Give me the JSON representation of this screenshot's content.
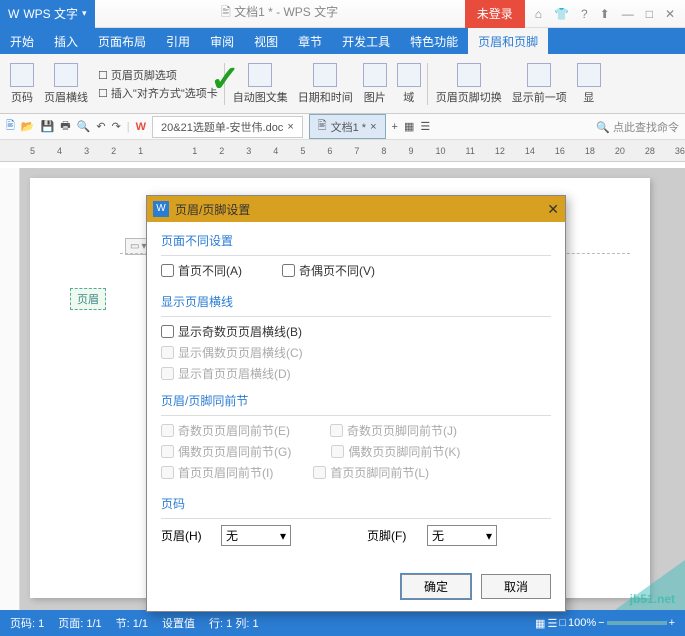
{
  "app": {
    "name": "WPS 文字",
    "docTitle": "文档1 * - WPS 文字",
    "loginLabel": "未登录"
  },
  "menuTabs": [
    "开始",
    "插入",
    "页面布局",
    "引用",
    "审阅",
    "视图",
    "章节",
    "开发工具",
    "特色功能",
    "页眉和页脚"
  ],
  "ribbon": {
    "pageNum": "页码",
    "headerLine": "页眉横线",
    "optionLabel": "页眉页脚选项",
    "insertAlign": "插入\"对齐方式\"选项卡",
    "autoImg": "自动图文集",
    "dateTime": "日期和时间",
    "picture": "图片",
    "field": "域",
    "hfSwitch": "页眉页脚切换",
    "showPrev": "显示前一项",
    "showNext": "显"
  },
  "docTabs": {
    "doc1": "20&21选题单-安世伟.doc",
    "doc2": "文档1 *",
    "searchPlaceholder": "点此查找命令"
  },
  "rulerMarks": [
    "5",
    "4",
    "3",
    "2",
    "1",
    "",
    "1",
    "2",
    "3",
    "4",
    "5",
    "6",
    "7",
    "8",
    "9",
    "10",
    "11",
    "12",
    "14",
    "16",
    "18",
    "20",
    "28",
    "36"
  ],
  "pageMarkers": {
    "header": "页眉",
    "docIcon": "▭"
  },
  "dialog": {
    "title": "页眉/页脚设置",
    "group1": {
      "title": "页面不同设置",
      "firstPage": "首页不同(A)",
      "oddEven": "奇偶页不同(V)"
    },
    "group2": {
      "title": "显示页眉横线",
      "oddLine": "显示奇数页页眉横线(B)",
      "evenLine": "显示偶数页页眉横线(C)",
      "firstLine": "显示首页页眉横线(D)"
    },
    "group3": {
      "title": "页眉/页脚同前节",
      "r1a": "奇数页页眉同前节(E)",
      "r1b": "奇数页页脚同前节(J)",
      "r2a": "偶数页页眉同前节(G)",
      "r2b": "偶数页页脚同前节(K)",
      "r3a": "首页页眉同前节(I)",
      "r3b": "首页页脚同前节(L)"
    },
    "group4": {
      "title": "页码",
      "headerLabel": "页眉(H)",
      "headerValue": "无",
      "footerLabel": "页脚(F)",
      "footerValue": "无"
    },
    "ok": "确定",
    "cancel": "取消"
  },
  "status": {
    "page": "页码: 1",
    "pageCount": "页面: 1/1",
    "section": "节: 1/1",
    "cursor": "设置值",
    "col": "行: 1 列: 1",
    "zoom": "100%"
  },
  "watermark": "jb51.net"
}
